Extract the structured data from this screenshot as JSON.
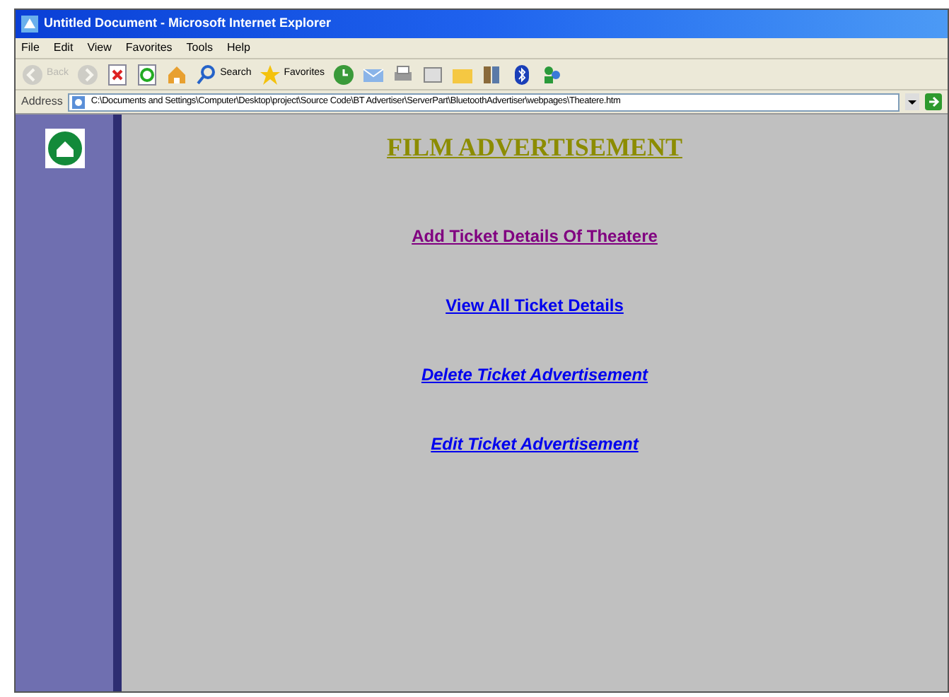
{
  "window": {
    "title": "Untitled Document - Microsoft Internet Explorer"
  },
  "menu": [
    "File",
    "Edit",
    "View",
    "Favorites",
    "Tools",
    "Help"
  ],
  "toolbar": [
    {
      "kind": "back",
      "label": "Back",
      "disabled": true
    },
    {
      "kind": "forward",
      "disabled": true
    },
    {
      "kind": "stop"
    },
    {
      "kind": "refresh"
    },
    {
      "kind": "home"
    },
    {
      "kind": "search",
      "label": "Search"
    },
    {
      "kind": "favorites",
      "label": "Favorites"
    },
    {
      "kind": "history"
    },
    {
      "kind": "mail"
    },
    {
      "kind": "print"
    },
    {
      "kind": "edit"
    },
    {
      "kind": "folder"
    },
    {
      "kind": "research"
    },
    {
      "kind": "bluetooth"
    },
    {
      "kind": "messenger"
    }
  ],
  "address_bar": {
    "label": "Address",
    "value": "C:\\Documents and Settings\\Computer\\Desktop\\project\\Source Code\\BT Advertiser\\ServerPart\\BluetoothAdvertiser\\webpages\\Theatere.htm"
  },
  "page": {
    "heading": "FILM ADVERTISEMENT",
    "links": [
      {
        "label": "Add Ticket Details Of Theatere",
        "visited": true,
        "italic": false
      },
      {
        "label": "View All Ticket Details",
        "visited": false,
        "italic": false
      },
      {
        "label": "Delete Ticket Advertisement",
        "visited": false,
        "italic": true
      },
      {
        "label": "Edit Ticket Advertisement",
        "visited": false,
        "italic": true
      }
    ]
  }
}
